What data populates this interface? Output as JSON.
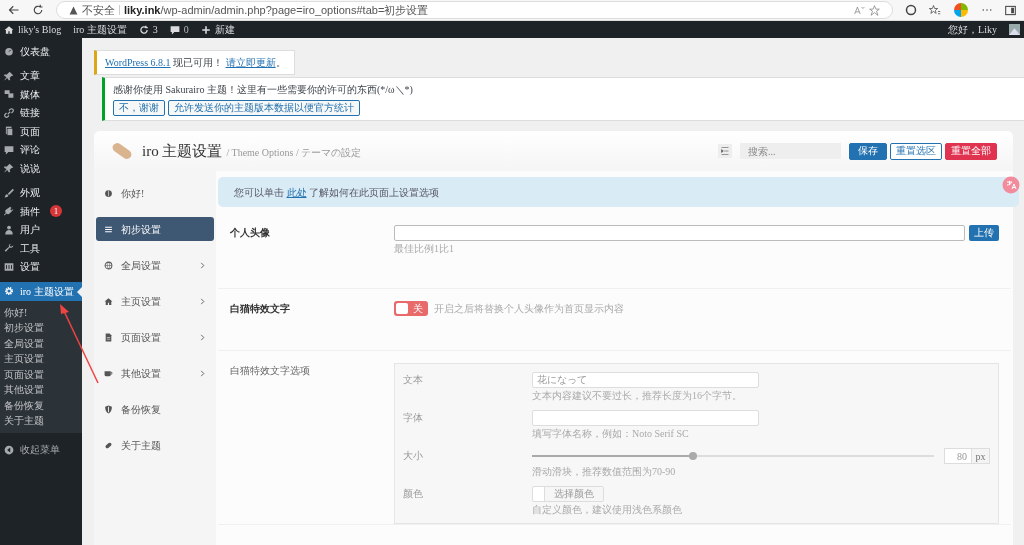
{
  "browser": {
    "security": "不安全",
    "url": "**liky.ink**/wp-admin/admin.php?page=iro_options#tab=初步设置"
  },
  "admin_bar": {
    "site": "liky's Blog",
    "theme": "iro 主题设置",
    "updates": "3",
    "comments": "0",
    "new": "新建",
    "greeting": "您好，Liky"
  },
  "sidebar": {
    "items": [
      {
        "label": "仪表盘",
        "selected": false
      },
      {
        "label": "文章",
        "selected": false
      },
      {
        "label": "媒体",
        "selected": false
      },
      {
        "label": "链接",
        "selected": false
      },
      {
        "label": "页面",
        "selected": false
      },
      {
        "label": "评论",
        "selected": false
      },
      {
        "label": "说说",
        "selected": false
      },
      {
        "label": "外观",
        "selected": false
      },
      {
        "label": "插件",
        "selected": false,
        "badge": "1"
      },
      {
        "label": "用户",
        "selected": false
      },
      {
        "label": "工具",
        "selected": false
      },
      {
        "label": "设置",
        "selected": false
      },
      {
        "label": "iro 主题设置",
        "selected": true,
        "children": [
          {
            "label": "你好!",
            "selected": false
          },
          {
            "label": "初步设置",
            "selected": false
          },
          {
            "label": "全局设置",
            "selected": false
          },
          {
            "label": "主页设置",
            "selected": false
          },
          {
            "label": "页面设置",
            "selected": false
          },
          {
            "label": "其他设置",
            "selected": false
          },
          {
            "label": "备份恢复",
            "selected": false
          },
          {
            "label": "关于主题",
            "selected": false
          }
        ]
      }
    ],
    "collapse": "收起菜单"
  },
  "notices": [
    {
      "kind": "update",
      "parts": [
        "WordPress 6.8.1",
        "现已可用！",
        "请立即更新",
        "。"
      ]
    },
    {
      "kind": "permission",
      "message": "感谢你使用 Sakurairo 主题！这里有一些需要你的许可的东西(*/ω＼*)",
      "buttons": [
        "不，谢谢",
        "允许发送你的主题版本数据以便官方统计"
      ]
    }
  ],
  "panel": {
    "title": "iro 主题设置",
    "subtitle": "/ Theme Options / テーマの設定",
    "search": {
      "placeholder": "搜索..."
    },
    "buttons": [
      {
        "label": "保存",
        "kind": "primary"
      },
      {
        "label": "重置选区",
        "kind": "outline"
      },
      {
        "label": "重置全部",
        "kind": "danger"
      }
    ],
    "nav": [
      {
        "label": "你好!",
        "selected": false,
        "has_children": false
      },
      {
        "label": "初步设置",
        "selected": true,
        "has_children": false
      },
      {
        "label": "全局设置",
        "selected": false,
        "has_children": true
      },
      {
        "label": "主页设置",
        "selected": false,
        "has_children": true
      },
      {
        "label": "页面设置",
        "selected": false,
        "has_children": true
      },
      {
        "label": "其他设置",
        "selected": false,
        "has_children": true
      },
      {
        "label": "备份恢复",
        "selected": false,
        "has_children": false
      },
      {
        "label": "关于主题",
        "selected": false,
        "has_children": false
      }
    ],
    "info": {
      "before": "您可以单击",
      "link": "此处",
      "after": "了解如何在此页面上设置选项"
    },
    "fields": [
      {
        "kind": "upload",
        "label": "个人头像",
        "button": "上传",
        "hint": "最佳比例1比1"
      },
      {
        "kind": "switch",
        "label": "白猫特效文字",
        "on": false,
        "switch_text": "关",
        "hint": "开启之后将替换个人头像作为首页显示内容"
      },
      {
        "kind": "group",
        "label": "白猫特效文字选项",
        "subfields": [
          {
            "kind": "text",
            "label": "文本",
            "value": "花になって",
            "hint": "文本内容建议不要过长，推荐长度为16个字节。"
          },
          {
            "kind": "text",
            "label": "字体",
            "hint": "填写字体名称，例如：Noto Serif SC"
          },
          {
            "kind": "slider",
            "label": "大小",
            "level": 0.4,
            "value": "80",
            "unit": "px",
            "hint": "滑动滑块，推荐数值范围为70-90"
          },
          {
            "kind": "color",
            "label": "颜色",
            "button": "选择颜色",
            "hint": "自定义颜色，建议使用浅色系颜色"
          }
        ]
      }
    ]
  }
}
